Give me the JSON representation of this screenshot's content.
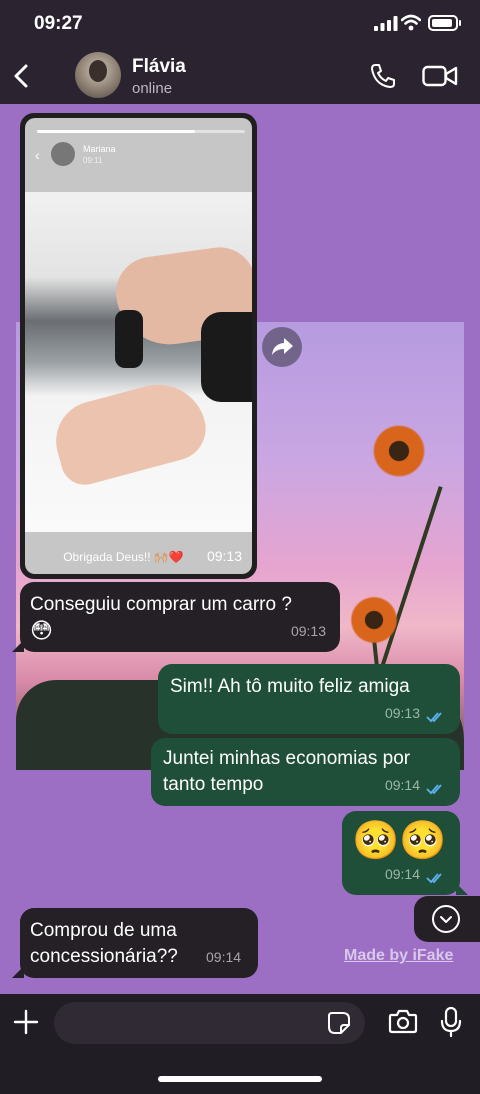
{
  "status_bar": {
    "time": "09:27"
  },
  "header": {
    "contact_name": "Flávia",
    "status": "online"
  },
  "story_reply": {
    "author": "Mariana",
    "time": "09:11",
    "caption": "Obrigada Deus!! 🙌🏼❤️",
    "timestamp": "09:13"
  },
  "messages": [
    {
      "direction": "in",
      "text": "Conseguiu comprar um carro ?",
      "emoji": "😳",
      "time": "09:13"
    },
    {
      "direction": "out",
      "text": "Sim!! Ah tô muito feliz amiga",
      "time": "09:13",
      "read": true
    },
    {
      "direction": "out",
      "text": "Juntei minhas economias por tanto tempo",
      "time": "09:14",
      "read": true
    },
    {
      "direction": "out",
      "text": "🥺🥺",
      "time": "09:14",
      "read": true
    },
    {
      "direction": "in",
      "text": "Comprou de uma concessionária??",
      "time": "09:14"
    }
  ],
  "watermark": "Made by iFake",
  "colors": {
    "accent_outgoing": "#1f4f39",
    "incoming": "#242026",
    "wallpaper": "#9d6fc4",
    "read_ticks": "#5ab0f0"
  },
  "icons": [
    "back-icon",
    "phone-icon",
    "video-icon",
    "share-icon",
    "scroll-down-icon",
    "plus-icon",
    "sticker-icon",
    "camera-icon",
    "mic-icon"
  ]
}
